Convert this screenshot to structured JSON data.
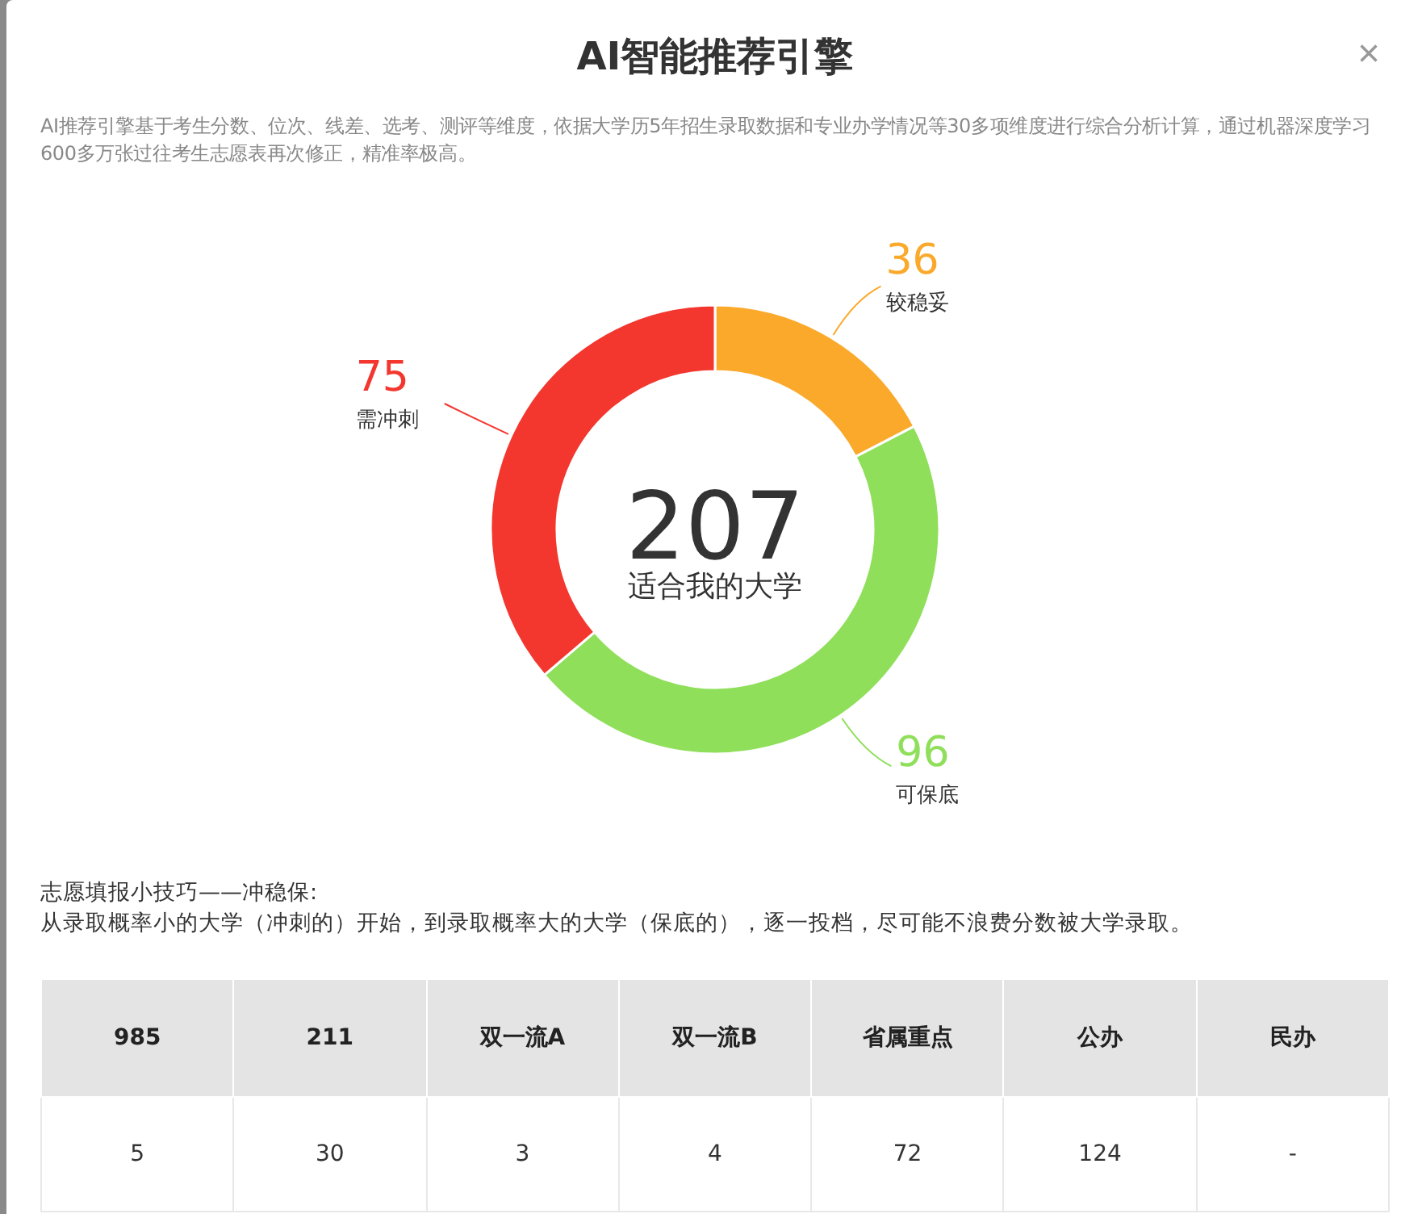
{
  "dialog": {
    "title": "AI智能推荐引擎",
    "close": "×",
    "description": "AI推荐引擎基于考生分数、位次、线差、选考、测评等维度，依据大学历5年招生录取数据和专业办学情况等30多项维度进行综合分析计算，通过机器深度学习600多万张过往考生志愿表再次修正，精准率极高。",
    "chart": {
      "center_value": "207",
      "chart_data": {
        "type": "donut",
        "categories": [
          "较稳妥",
          "可保底",
          "需冲刺"
        ],
        "colors": [
          "#fba92b",
          "#8fdf5a",
          "#f3372f"
        ],
        "series": [
          {
            "name": "适合我的大学",
            "values": [
              36,
              96,
              75
            ]
          }
        ],
        "data_labels": true
      }
    },
    "tips": [
      "志愿填报小技巧——冲稳保:",
      "从录取概率小的大学（冲刺的）开始，到录取概率大的大学（保底的），逐一投档，尽可能不浪费分数被大学录取。"
    ],
    "table": {
      "columns": [
        "985",
        "211",
        "双一流A",
        "双一流B",
        "省属重点",
        "公办",
        "民办"
      ],
      "rows": [
        [
          "5",
          "30",
          "3",
          "4",
          "72",
          "124",
          "-"
        ]
      ]
    }
  }
}
